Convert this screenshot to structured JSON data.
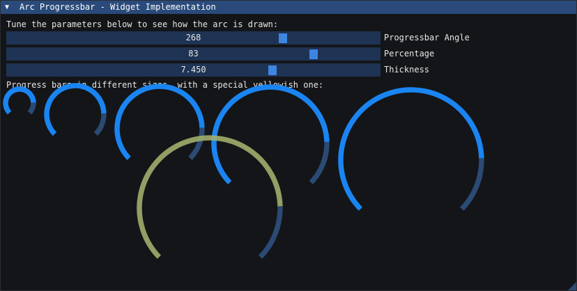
{
  "window": {
    "title": "Arc Progressbar - Widget Implementation",
    "collapse_glyph": "▼"
  },
  "intro_text": "Tune the parameters below to see how the arc is drawn:",
  "sliders": [
    {
      "value_text": "268",
      "label": "Progressbar Angle",
      "fraction": 0.737
    },
    {
      "value_text": "83",
      "label": "Percentage",
      "fraction": 0.822
    },
    {
      "value_text": "7.450",
      "label": "Thickness",
      "fraction": 0.711
    }
  ],
  "section_text": "Progress bars in different sizes, with a special yellowish one:",
  "progress": {
    "angle_deg": 268,
    "percentage": 83,
    "thickness": 7.45,
    "fill_color": "#1a85f2",
    "track_color": "#2b4a74",
    "special_fill_color": "#a0ad6b"
  }
}
